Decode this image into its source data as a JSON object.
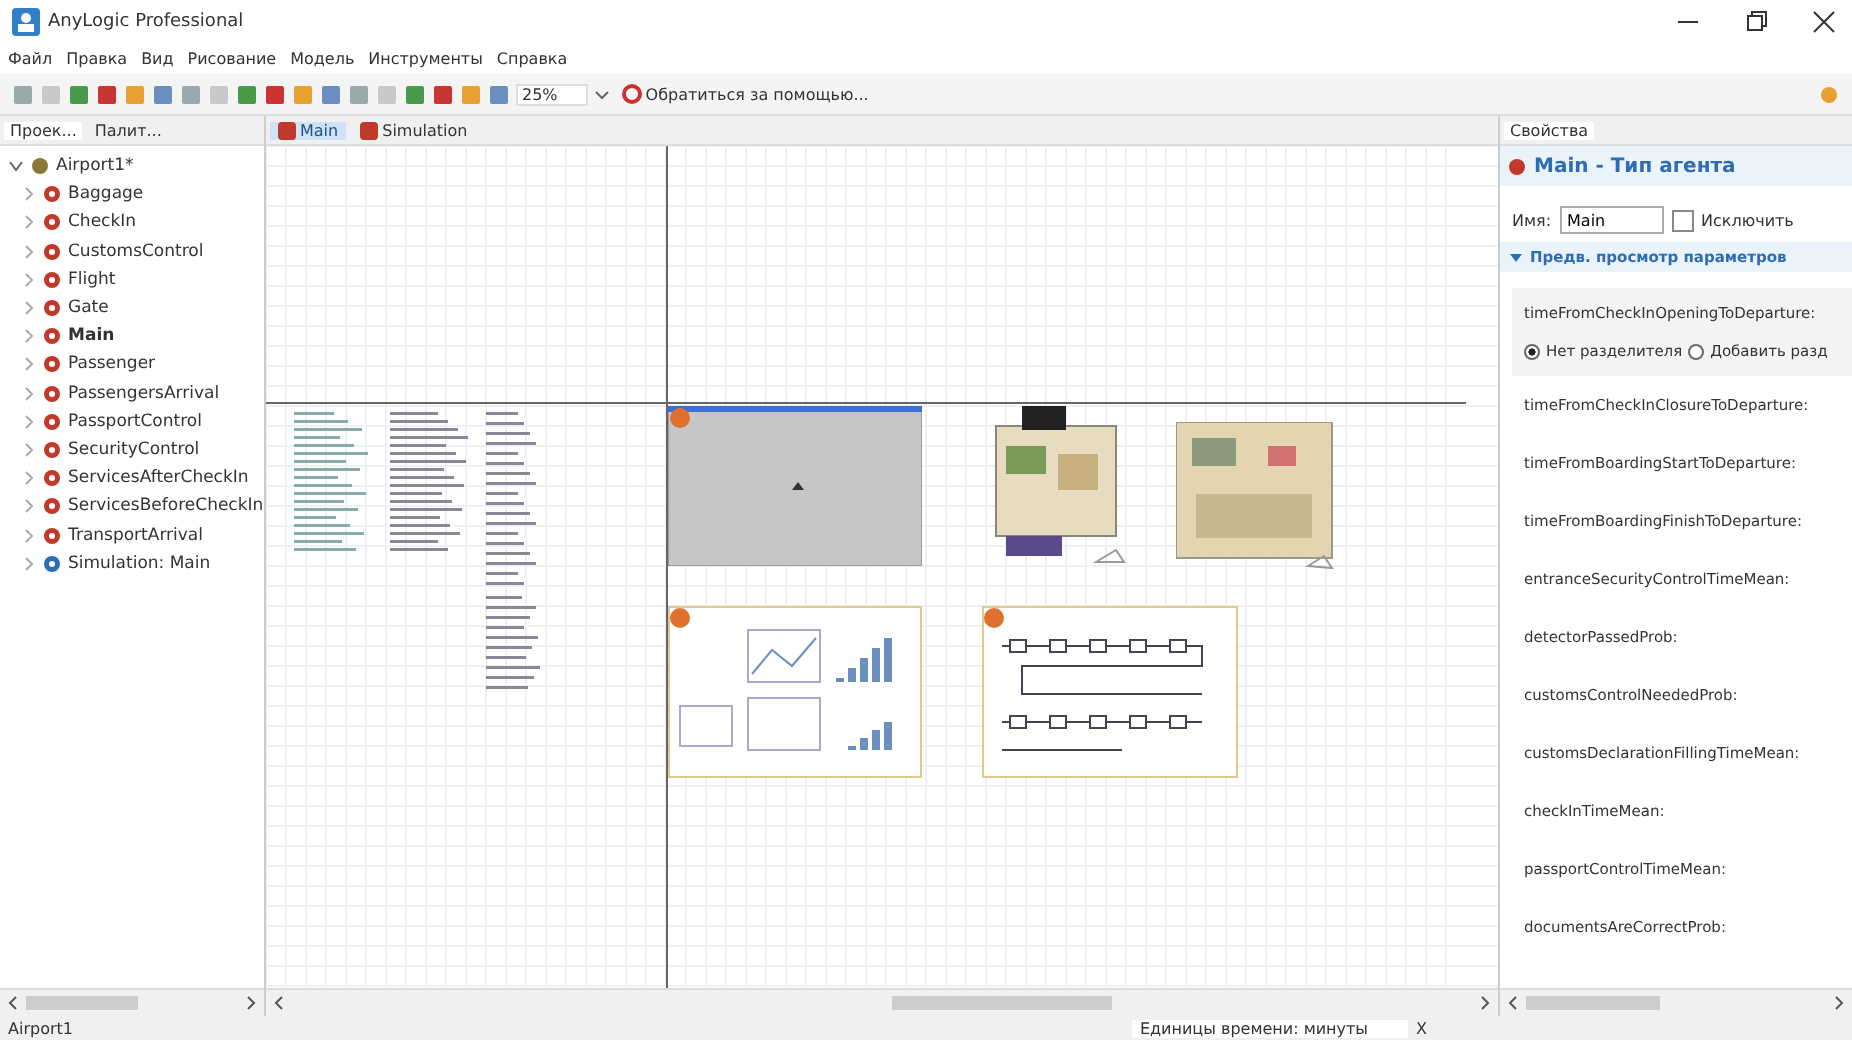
{
  "window": {
    "title": "AnyLogic Professional"
  },
  "menu": [
    "Файл",
    "Правка",
    "Вид",
    "Рисование",
    "Модель",
    "Инструменты",
    "Справка"
  ],
  "toolbar": {
    "zoom": "25%",
    "help": "Обратиться за помощью..."
  },
  "left_tabs": [
    {
      "label": "Проек...",
      "selected": true
    },
    {
      "label": "Палит...",
      "selected": false
    }
  ],
  "editor_tabs": [
    {
      "label": "Main",
      "selected": true
    },
    {
      "label": "Simulation",
      "selected": false
    }
  ],
  "tree": [
    {
      "label": "Airport1*",
      "kind": "model",
      "expanded": true,
      "children": [
        {
          "label": "Baggage",
          "kind": "agent",
          "active": false
        },
        {
          "label": "CheckIn",
          "kind": "agent",
          "active": false
        },
        {
          "label": "CustomsControl",
          "kind": "agent",
          "active": false
        },
        {
          "label": "Flight",
          "kind": "agent",
          "active": false
        },
        {
          "label": "Gate",
          "kind": "agent",
          "active": false
        },
        {
          "label": "Main",
          "kind": "agent",
          "active": true
        },
        {
          "label": "Passenger",
          "kind": "agent",
          "active": false
        },
        {
          "label": "PassengersArrival",
          "kind": "agent",
          "active": false
        },
        {
          "label": "PassportControl",
          "kind": "agent",
          "active": false
        },
        {
          "label": "SecurityControl",
          "kind": "agent",
          "active": false
        },
        {
          "label": "ServicesAfterCheckIn",
          "kind": "agent",
          "active": false
        },
        {
          "label": "ServicesBeforeCheckIn",
          "kind": "agent",
          "active": false
        },
        {
          "label": "TransportArrival",
          "kind": "agent",
          "active": false
        },
        {
          "label": "Simulation: Main",
          "kind": "experiment",
          "active": false
        }
      ]
    }
  ],
  "properties": {
    "tab": "Свойства",
    "title": "Main - Тип агента",
    "name_label": "Имя:",
    "name_value": "Main",
    "exclude": {
      "label": "Исключить",
      "checked": false
    },
    "section": {
      "label": "Предв. просмотр параметров",
      "expanded": true
    },
    "first_param": {
      "label": "timeFromCheckInOpeningToDeparture:",
      "options": [
        {
          "label": "Нет разделителя",
          "selected": true
        },
        {
          "label": "Добавить разд",
          "selected": false
        }
      ]
    },
    "params": [
      "timeFromCheckInClosureToDeparture:",
      "timeFromBoardingStartToDeparture:",
      "timeFromBoardingFinishToDeparture:",
      "entranceSecurityControlTimeMean:",
      "detectorPassedProb:",
      "customsControlNeededProb:",
      "customsDeclarationFillingTimeMean:",
      "checkInTimeMean:",
      "passportControlTimeMean:",
      "documentsAreCorrectProb:"
    ]
  },
  "status_bar": {
    "left": "Airport1",
    "units": "Единицы времени: минуты",
    "close": "X"
  }
}
